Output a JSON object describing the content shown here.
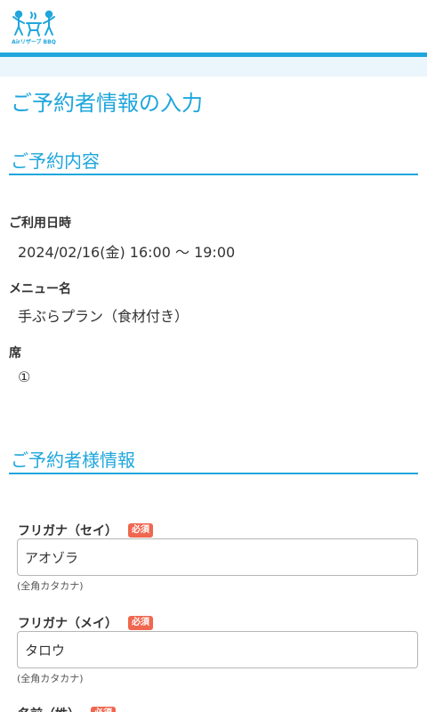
{
  "header": {
    "logo_text": "Airリザーブ BBQ",
    "brand_color": "#1fa6dc"
  },
  "page_title": "ご予約者情報の入力",
  "reservation": {
    "section_title": "ご予約内容",
    "date_label": "ご利用日時",
    "date_value": "2024/02/16(金) 16:00 〜 19:00",
    "menu_label": "メニュー名",
    "menu_value": "手ぶらプラン（食材付き）",
    "seat_label": "席",
    "seat_value": "①"
  },
  "customer": {
    "section_title": "ご予約者様情報",
    "required_badge": "必須",
    "required_color": "#f0674f",
    "fields": [
      {
        "label": "フリガナ（セイ）",
        "value": "アオゾラ",
        "hint": "(全角カタカナ)"
      },
      {
        "label": "フリガナ（メイ）",
        "value": "タロウ",
        "hint": "(全角カタカナ)"
      },
      {
        "label": "名前（姓）"
      }
    ]
  }
}
